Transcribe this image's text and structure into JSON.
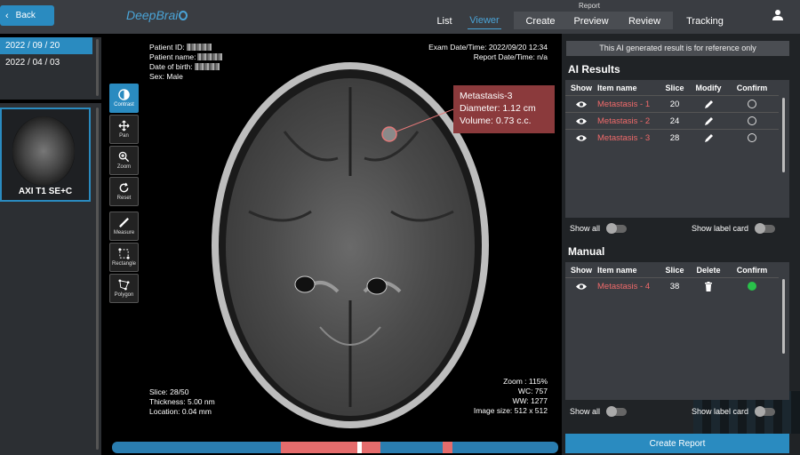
{
  "header": {
    "back_label": "Back",
    "logo": "DeepBrai",
    "report_caption": "Report",
    "tabs": [
      {
        "label": "List"
      },
      {
        "label": "Viewer"
      },
      {
        "label": "Create"
      },
      {
        "label": "Preview"
      },
      {
        "label": "Review"
      },
      {
        "label": "Tracking"
      }
    ],
    "active_tab": "Viewer"
  },
  "dates": [
    "2022 / 09 / 20",
    "2022 / 04 / 03"
  ],
  "series": {
    "label": "AXI T1 SE+C"
  },
  "tools": [
    {
      "label": "Contrast",
      "icon": "contrast-icon"
    },
    {
      "label": "Pan",
      "icon": "pan-icon"
    },
    {
      "label": "Zoom",
      "icon": "zoom-icon"
    },
    {
      "label": "Reset",
      "icon": "reset-icon"
    },
    {
      "label": "Measure",
      "icon": "ruler-icon"
    },
    {
      "label": "Rectangle",
      "icon": "rectangle-icon"
    },
    {
      "label": "Polygon",
      "icon": "polygon-icon"
    }
  ],
  "overlay": {
    "patient_id": "Patient ID:",
    "patient_name": "Patient name:",
    "dob": "Date of birth:",
    "sex": "Sex: Male",
    "exam_dt": "Exam Date/Time: 2022/09/20 12:34",
    "report_dt": "Report Date/Time: n/a",
    "slice": "Slice: 28/50",
    "thickness": "Thickness: 5.00 nm",
    "location": "Location: 0.04 mm",
    "zoom": "Zoom : 115%",
    "wc": "WC: 757",
    "ww": "WW: 1277",
    "image_size": "Image size: 512 x 512"
  },
  "label_card": {
    "name": "Metastasis-3",
    "diameter": "Diameter: 1.12 cm",
    "volume": "Volume: 0.73 c.c."
  },
  "slice_slider": {
    "current_slice": 28,
    "total_slices": 50
  },
  "notice": "This AI generated result is for reference only",
  "ai_results": {
    "title": "AI Results",
    "columns": [
      "Show",
      "Item name",
      "Slice",
      "Modify",
      "Confirm"
    ],
    "rows": [
      {
        "name": "Metastasis - 1",
        "slice": "20"
      },
      {
        "name": "Metastasis - 2",
        "slice": "24"
      },
      {
        "name": "Metastasis - 3",
        "slice": "28"
      }
    ],
    "show_all": "Show all",
    "show_label_card": "Show label card"
  },
  "manual": {
    "title": "Manual",
    "columns": [
      "Show",
      "Item name",
      "Slice",
      "Delete",
      "Confirm"
    ],
    "rows": [
      {
        "name": "Metastasis - 4",
        "slice": "38"
      }
    ],
    "show_all": "Show all",
    "show_label_card": "Show label card"
  },
  "create_report": "Create Report",
  "colors": {
    "accent": "#2a8bc0",
    "lesion": "#ef6a6a",
    "confirmed": "#29c14a",
    "card": "#8b3a3c"
  }
}
